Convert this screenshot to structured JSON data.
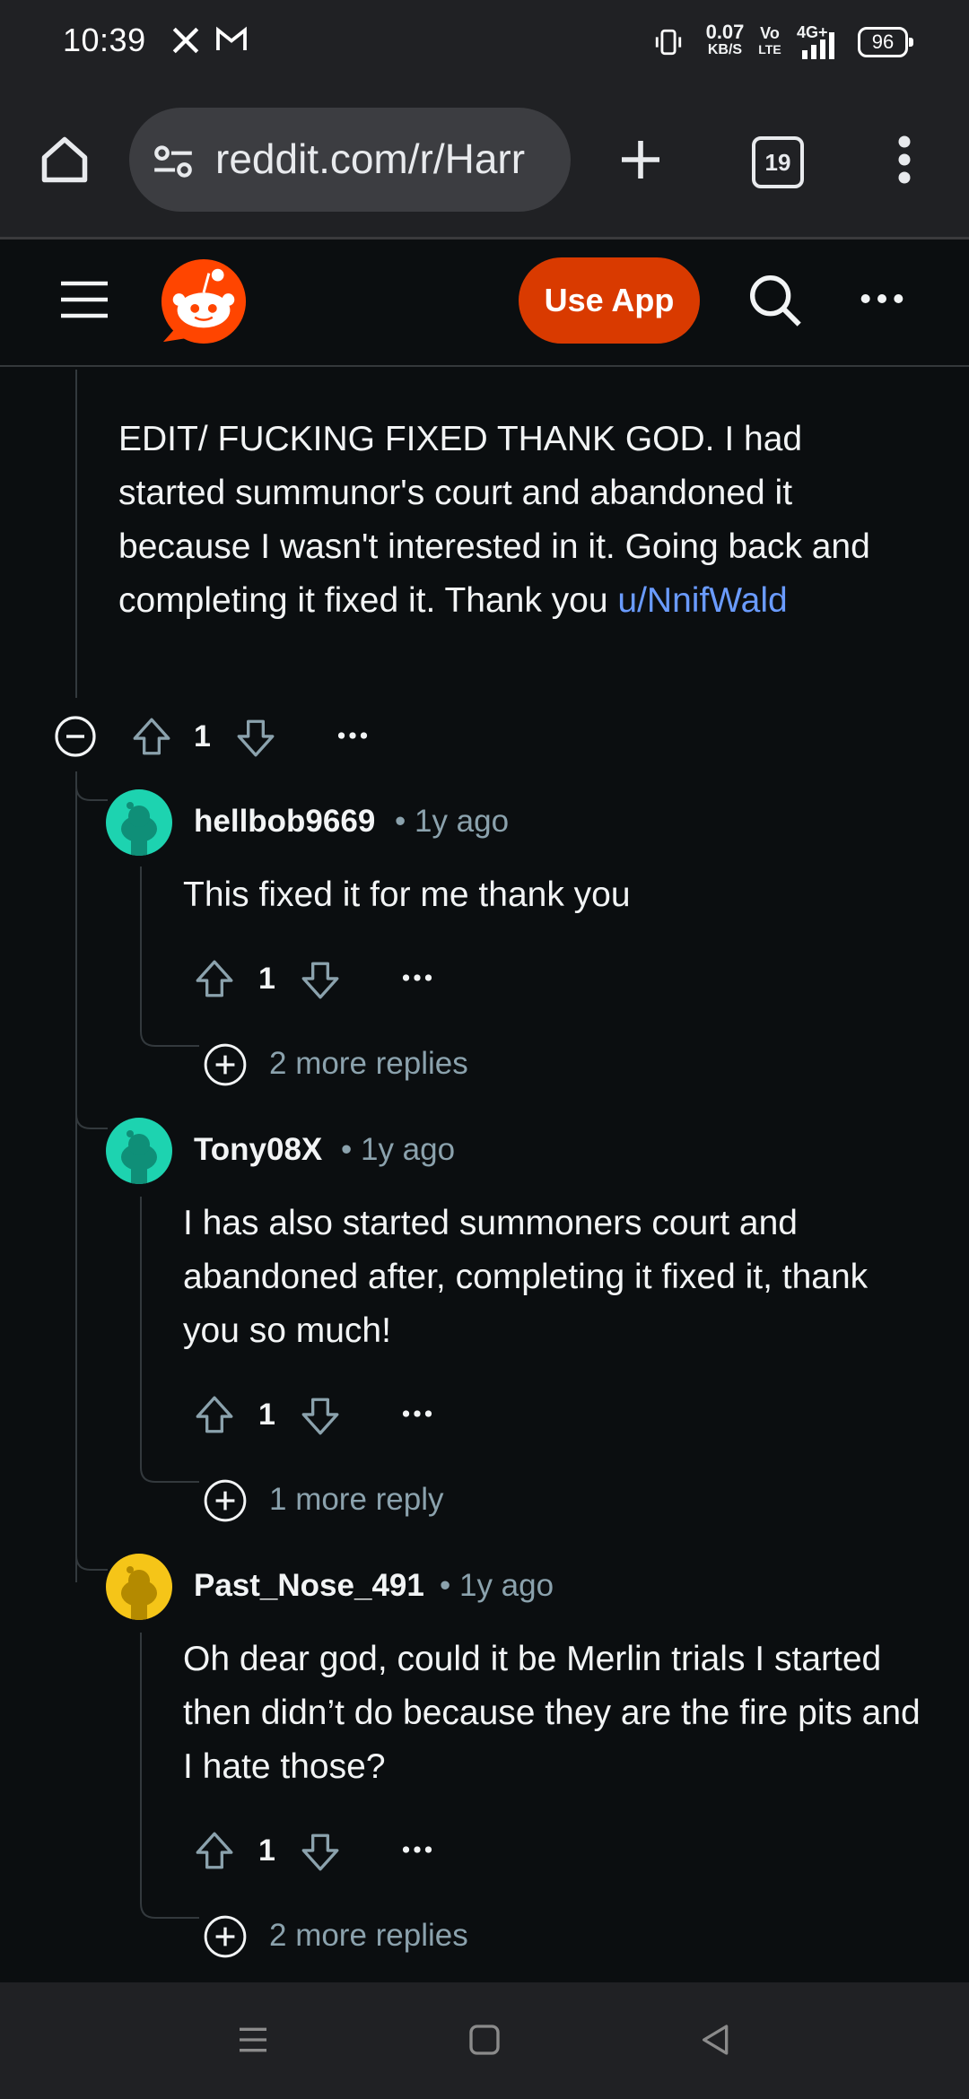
{
  "status_bar": {
    "time": "10:39",
    "notif_icons": [
      "x-icon",
      "gmail-icon"
    ],
    "net_speed_value": "0.07",
    "net_speed_unit": "KB/S",
    "volte_top": "Vo",
    "volte_bottom": "LTE",
    "network": "4G+",
    "battery": "96"
  },
  "browser": {
    "url": "reddit.com/r/Harr",
    "tab_count": "19"
  },
  "reddit_header": {
    "use_app_label": "Use App",
    "brand_color": "#ff4500",
    "button_color": "#d93a00"
  },
  "top_comment": {
    "text": "EDIT/ FUCKING FIXED THANK GOD. I had started summunor's court and abandoned it because I wasn't interested in it. Going back and completing it fixed it. Thank you",
    "mention": "u/NnifWald",
    "votes": "1",
    "collapse_icon": "collapse-icon"
  },
  "replies": [
    {
      "username": "hellbob9669",
      "age": "1y ago",
      "text": "This fixed it for me thank you",
      "votes": "1",
      "more_replies": "2 more replies",
      "avatar_color": "#1dd3b0"
    },
    {
      "username": "Tony08X",
      "age": "1y ago",
      "text": "I has also started summoners court and abandoned after, completing it fixed it, thank you so much!",
      "votes": "1",
      "more_replies": "1 more reply",
      "avatar_color": "#1dd3b0"
    },
    {
      "username": "Past_Nose_491",
      "age": "1y ago",
      "text": "Oh dear god, could it be Merlin trials I started then didn’t do because they are the fire pits and I hate those?",
      "votes": "1",
      "more_replies": "2 more replies",
      "avatar_color": "#f5c518"
    }
  ],
  "nav_bar": {
    "icons": [
      "menu-icon",
      "home-square-icon",
      "back-triangle-icon"
    ]
  }
}
